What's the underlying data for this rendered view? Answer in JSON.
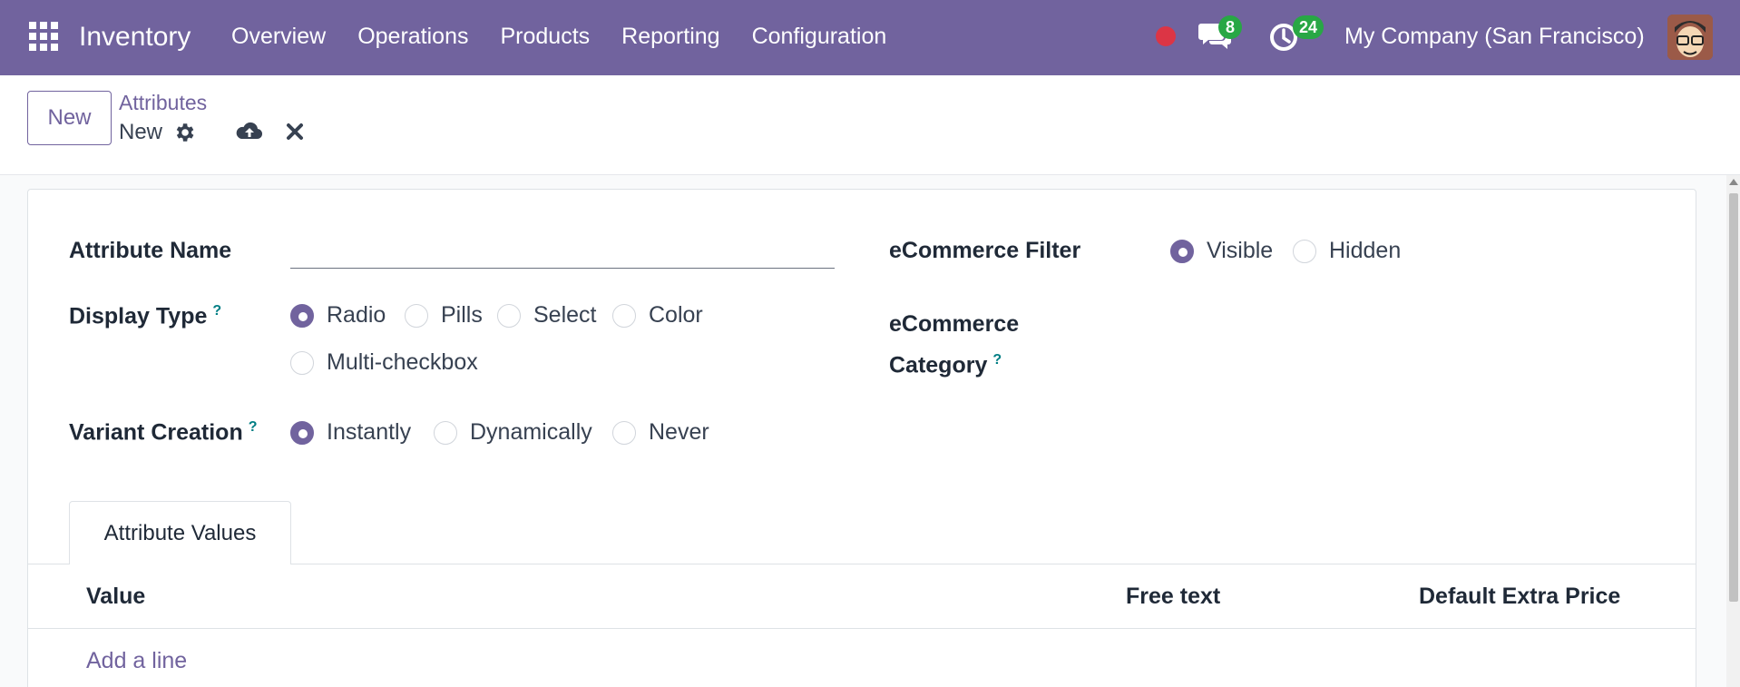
{
  "navbar": {
    "app_name": "Inventory",
    "menu": [
      "Overview",
      "Operations",
      "Products",
      "Reporting",
      "Configuration"
    ],
    "messages_count": "8",
    "activities_count": "24",
    "company": "My Company (San Francisco)",
    "accent_color": "#71639e",
    "icons": [
      "apps-grid-icon",
      "recording-dot-icon",
      "chat-icon",
      "activity-clock-icon",
      "user-avatar"
    ]
  },
  "control_panel": {
    "new_button": "New",
    "breadcrumb": "Attributes",
    "record_name": "New",
    "icons": [
      "gear-icon",
      "save-cloud-icon",
      "discard-x-icon"
    ]
  },
  "form": {
    "attribute_name": {
      "label": "Attribute Name",
      "value": ""
    },
    "display_type": {
      "label": "Display Type",
      "help": "?",
      "options": [
        "Radio",
        "Pills",
        "Select",
        "Color",
        "Multi-checkbox"
      ],
      "selected": "Radio"
    },
    "variant_creation": {
      "label": "Variant Creation",
      "help": "?",
      "options": [
        "Instantly",
        "Dynamically",
        "Never"
      ],
      "selected": "Instantly"
    },
    "ecommerce_filter": {
      "label": "eCommerce Filter",
      "options": [
        "Visible",
        "Hidden"
      ],
      "selected": "Visible"
    },
    "ecommerce_category": {
      "label_line1": "eCommerce",
      "label_line2": "Category",
      "help": "?"
    }
  },
  "tabs": {
    "active": "Attribute Values",
    "columns": [
      "Value",
      "Free text",
      "Default Extra Price"
    ],
    "add_line": "Add a line"
  }
}
